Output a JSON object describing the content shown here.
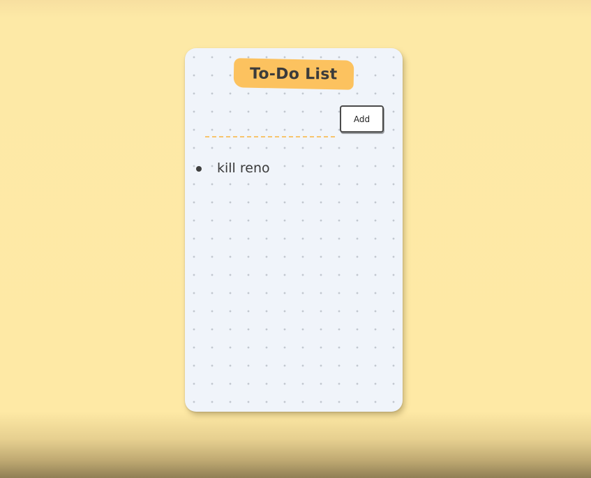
{
  "app": {
    "title": "To-Do List"
  },
  "input": {
    "value": "",
    "placeholder": ""
  },
  "add_button": {
    "label": "Add"
  },
  "tasks": [
    {
      "text": "kill reno"
    }
  ],
  "colors": {
    "page_background": "#fee9a5",
    "card_background": "#f0f4fa",
    "title_highlight": "#fcc25f",
    "input_underline": "#f7c46c",
    "text": "#3a3a3a"
  }
}
